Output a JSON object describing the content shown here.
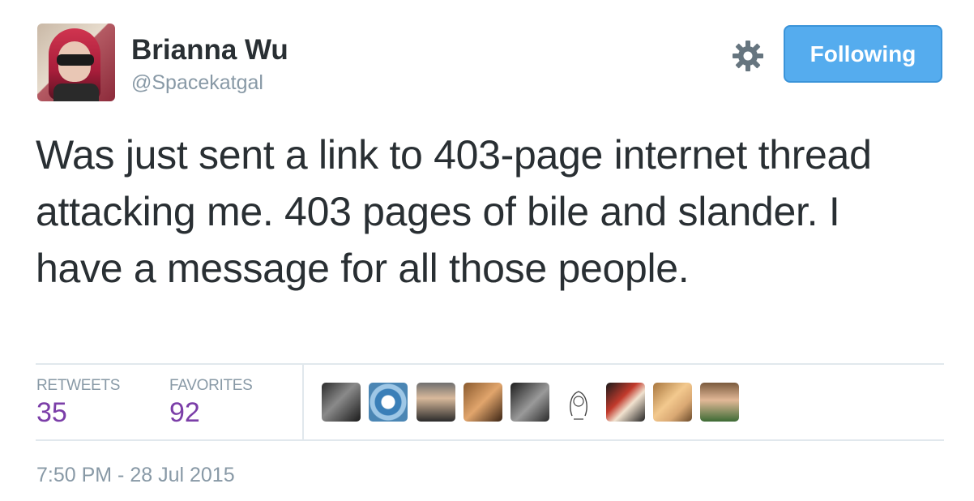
{
  "user": {
    "name": "Brianna Wu",
    "handle": "@Spacekatgal"
  },
  "actions": {
    "settings_icon": "gear-icon",
    "follow_label": "Following",
    "follow_color": "#55acee"
  },
  "tweet": {
    "text": "Was just sent a link to 403-page internet thread attacking me. 403 pages of bile and slander. I have a message for all those people."
  },
  "stats": {
    "retweets_label": "RETWEETS",
    "retweets_count": "35",
    "favorites_label": "FAVORITES",
    "favorites_count": "92",
    "count_color": "#7b3ea8"
  },
  "favoriters": [
    "favoriter-avatar-1",
    "favoriter-avatar-2",
    "favoriter-avatar-3",
    "favoriter-avatar-4",
    "favoriter-avatar-5",
    "favoriter-avatar-6",
    "favoriter-avatar-7",
    "favoriter-avatar-8",
    "favoriter-avatar-9"
  ],
  "timestamp": "7:50 PM - 28 Jul 2015"
}
